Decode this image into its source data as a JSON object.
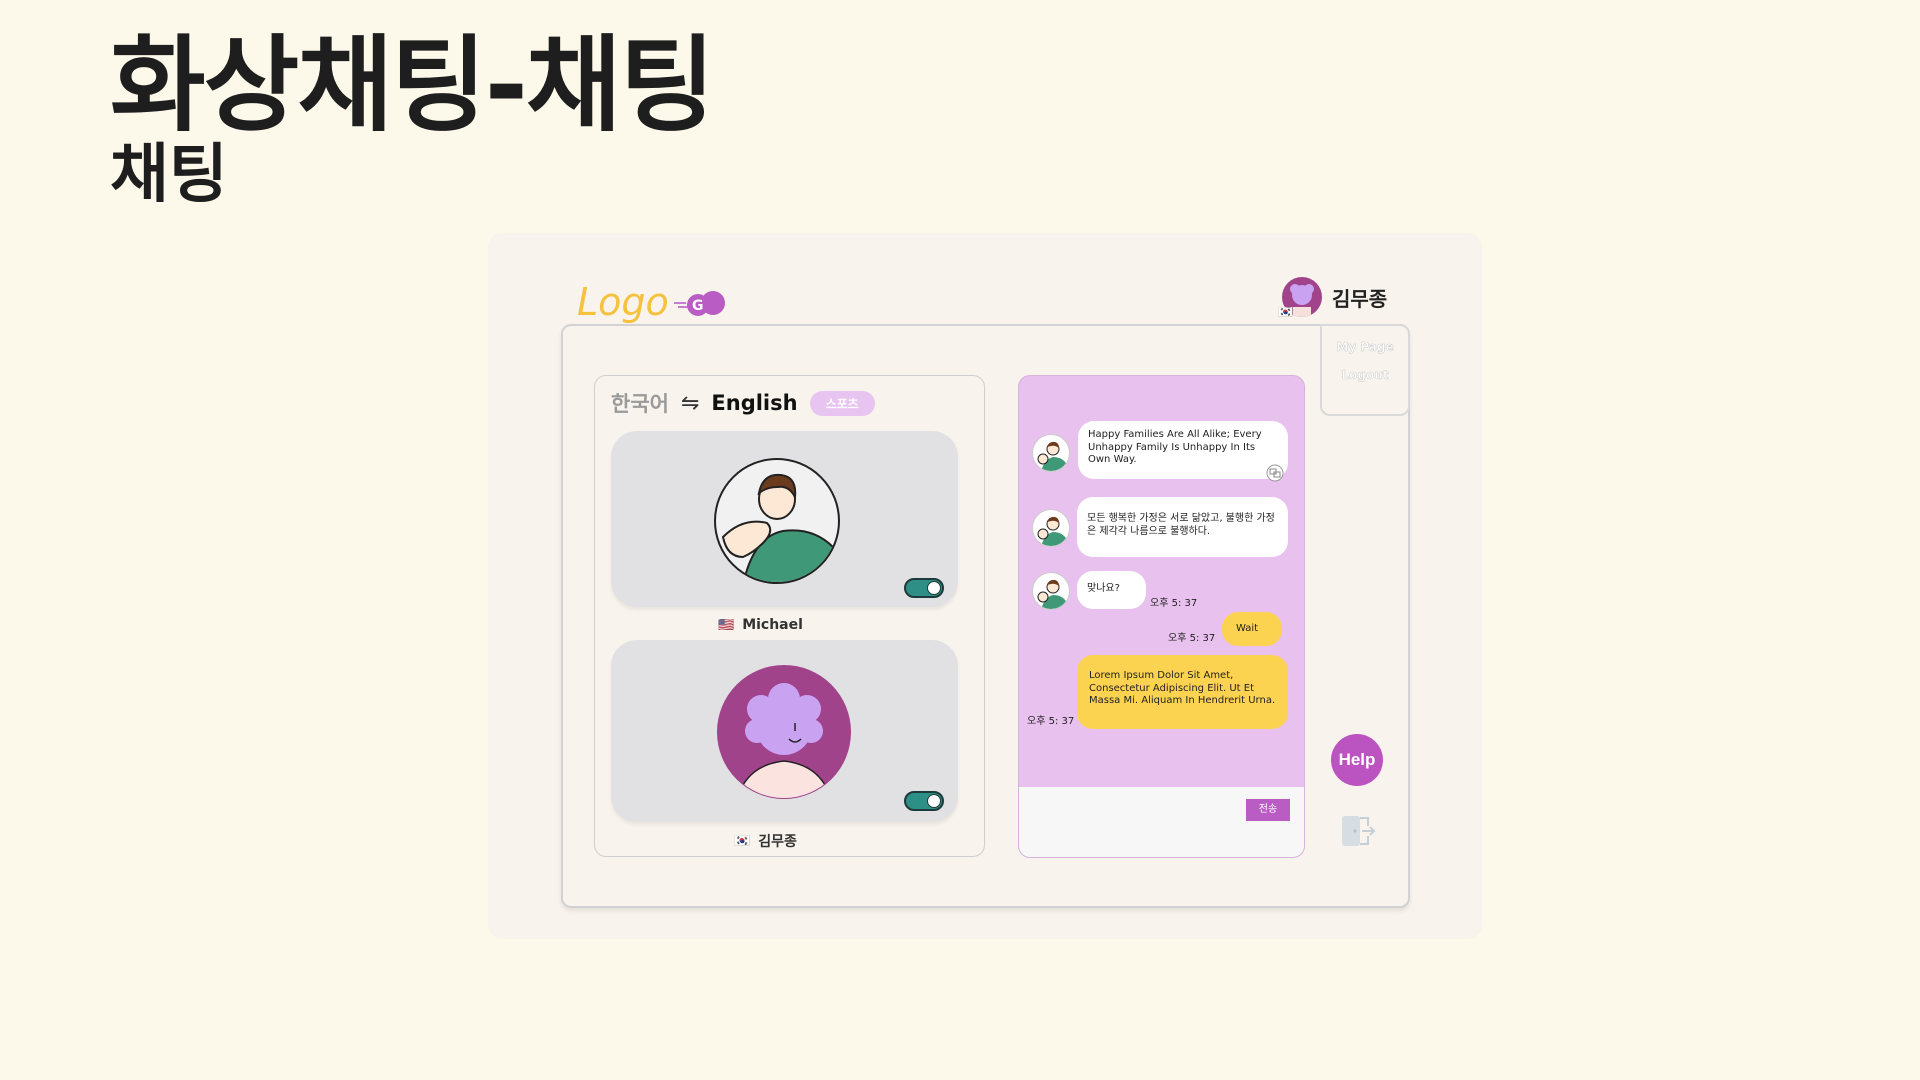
{
  "slide": {
    "title": "화상채팅-채팅",
    "subtitle": "채팅"
  },
  "header": {
    "logo_text": "Logo",
    "user_name": "김무종",
    "user_flag": "🇰🇷"
  },
  "side_menu": {
    "items": [
      "My Page",
      "Logout"
    ]
  },
  "language_bar": {
    "from": "한국어",
    "swap_symbol": "⇋",
    "to": "English",
    "topic": "스포츠"
  },
  "participants": [
    {
      "name": "Michael",
      "flag": "🇺🇸",
      "camera_on": true
    },
    {
      "name": "김무종",
      "flag": "🇰🇷",
      "camera_on": true
    }
  ],
  "chat": {
    "messages": [
      {
        "direction": "in",
        "text": "Happy Families Are All Alike; Every Unhappy Family Is Unhappy In Its Own Way.",
        "time": ""
      },
      {
        "direction": "in",
        "text": "모든 행복한 가정은 서로 닮았고, 불행한 가정은 제각각 나름으로 불행하다.",
        "time": ""
      },
      {
        "direction": "in",
        "text": "맞나요?",
        "time": "오후 5: 37"
      },
      {
        "direction": "out",
        "text": "Wait",
        "time": "오후 5: 37"
      },
      {
        "direction": "out",
        "text": "Lorem Ipsum Dolor Sit Amet, Consectetur Adipiscing Elit. Ut Et Massa Mi. Aliquam In Hendrerit Urna.",
        "time": "오후 5: 37"
      }
    ],
    "send_label": "전송"
  },
  "help_label": "Help",
  "colors": {
    "background": "#fdf9ea",
    "accent_purple": "#bb53c1",
    "chat_bg": "#e8c1ee",
    "out_bubble": "#fcd351",
    "logo_yellow": "#f6c23e",
    "toggle_teal": "#2e8f86"
  }
}
